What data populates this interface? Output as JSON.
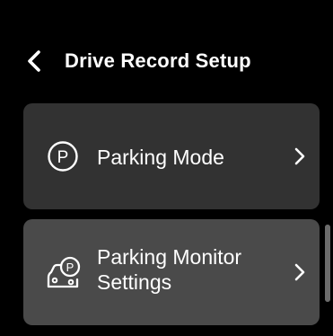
{
  "header": {
    "title": "Drive Record Setup",
    "back_icon": "chevron-left-icon"
  },
  "menu": {
    "items": [
      {
        "label": "Parking Mode",
        "icon": "parking-circle-icon",
        "icon_glyph": "P",
        "chevron": "chevron-right-icon"
      },
      {
        "label_line1": "Parking Monitor",
        "label_line2": "Settings",
        "icon": "parked-car-monitor-icon",
        "icon_glyph": "P",
        "chevron": "chevron-right-icon"
      }
    ]
  },
  "colors": {
    "background": "#000000",
    "card_default": "#323232",
    "card_selected": "#4a4a4a",
    "text": "#ffffff"
  }
}
